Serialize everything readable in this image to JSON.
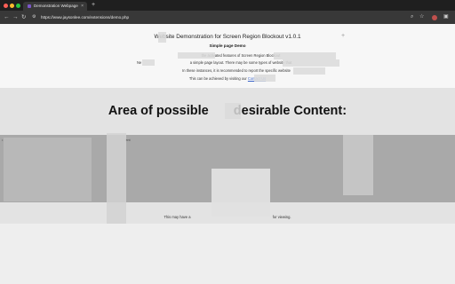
{
  "browser": {
    "tab_title": "Demonstration Webpage",
    "tab_close": "×",
    "new_tab": "+",
    "url": "https://www.jaysonlee.com/extensions/demo.php",
    "colors": {
      "close": "#ff5f57",
      "minimize": "#febc2e",
      "zoom": "#28c840"
    }
  },
  "page": {
    "title": "Website Demonstration for Screen Region Blockout v1.0.1",
    "subtitle": "Simple page Demo",
    "para1": "the activated features of Screen Region Blockout",
    "para2": "a simple page layout. There may be some types of website that",
    "para3": "In these instances, it is recommended to report the specific website",
    "para4_pre": "This can be achieved by visiting our",
    "para4_link": "Contact Us",
    "ne_fragment": "Ne",
    "heading_pre": "Area of possible",
    "heading_post": "desirable Content:",
    "content_word": "ent",
    "note_pre": "This may have a",
    "note_post": "for viewing.",
    "plus": "+"
  }
}
